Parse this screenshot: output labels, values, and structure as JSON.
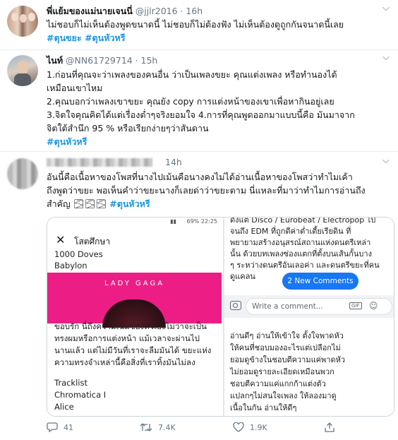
{
  "tweet1": {
    "name": "พี่แย้มของแม่นายเจนนี่",
    "handle": "@jjlr2016",
    "time": "· 16h",
    "text": "ไม่ชอบก็ไม่เห็นต้องพูดขนาดนี้ ไม่ชอบก็ไม่ต้องฟัง ไม่เห็นต้องดูถูกกันจนาดนี้เลย",
    "tags": "#ตุนขยะ #ตุนหัวหรี"
  },
  "tweet2": {
    "name": "ไนท์",
    "handle": "@NN61729714",
    "time": "· 15h",
    "lines": [
      "1.ก่อนที่คุณจะว่าเพลงของคนอื่น ว่าเป็นเพลงขยะ คุณแต่งเพลง หรือทำนองได้",
      "เหมือนเขาไหม",
      "2.คุณบอกว่าเพลงเขาขยะ คุณยัง copy การแต่งหน้าของเขาเพื่อหากินอยู่เลย",
      "3.จิตใจคุณคิดได้แต่เรื่องต่ำๆจริงยอมใจ 4.การที่คุณพูดออกมาแบบนี้คือ มันมาจาก",
      "จิตใต้สำนึก 95 % หรือเรียกง่ายๆว่าสันดาน"
    ],
    "tag": "#ตุนหัวหรี"
  },
  "tweet3": {
    "time": "14h",
    "lines": [
      "อันนี้คือเนื้อหาของโพสที่นางไปเม้นคือนางคงไม่ได้อ่านเนื้อหาของโพสว่าทำไมเค้า",
      "ถึงพูดว่าขยะ พอเห็นคำว่าขยะนางก็เลยด่าว่าขยะตาม นี่แหละที่มาว่าทำไมการอ่านถึง",
      "สำคัญ"
    ],
    "emoji": "🌫🌫🌫",
    "tag": "#ตุนหัวหรี"
  },
  "media": {
    "left": {
      "status": "69% 22:25",
      "title": "โสตศึกษา",
      "list_top": [
        "1000 Doves",
        "Babylon"
      ],
      "banner": "LADY GAGA",
      "paragraph": [
        "ขอบรัก นี่ถึงความเฉิ่มของตัวเองไม่ว่าจะเป็น",
        "ทรงผมหรือการแต่งหน้า แม้เวลาจะผ่านไป",
        "นานแล้ว แต่ไม่มีวันที่เราจะลืมมันได้ ขยะแห่ง",
        "ความทรงจำเหล่านี้คือสิ่งที่เราทิ้งมันไม่ลง"
      ],
      "tracklist_label": "Tracklist",
      "tracks": [
        "Chromatica I",
        "Alice"
      ]
    },
    "right": {
      "top_lines": [
        "ดังแต่ Disco / Eurobeat / Electropop ไป",
        "จนถึง EDM ที่ถูกดีค่าต่ำเตี้ยเรียดิน ที่",
        "พยายามสร้างอนุสรณ์สถานแห่งดนตรีเหล่า",
        "นั้น ด้วยบทเพลงซ่องแตกที่ตั้งบนเส้นกั้นบาง",
        "ๆ ระหว่างดนตรีอันเลอค่า และดนตรีขยะที่คน",
        "ดูแคลน"
      ],
      "new_comments": "2 New Comments",
      "comment_placeholder": "Write a comment...",
      "gif": "GIF",
      "comment_lines": [
        "อ่านดีๆ อ่านให้เข้าใจ ตั้งใจพาดหัว",
        "ให้คนที่ชอบมองอะไรแต่เปลือกไม่",
        "ยอมดูข้างในชอบตีความแค่พาดหัว",
        "ไม่ยอมดูรายละเอียดเหมือนพวก",
        "ชอบตีความแค่แกกก้าแต่งตัว",
        "แปลกๆไม่สนใจเพลง ให้ลองมาดู",
        "เนื้อในกัน อ่านให้ดีๆ"
      ]
    }
  },
  "actions": {
    "replies": "41",
    "retweets": "7.4K",
    "likes": "1.9K"
  },
  "colors": {
    "link": "#1b95e0",
    "muted": "#657786",
    "banner": "#ec1e86",
    "fb_blue": "#1877f2"
  }
}
